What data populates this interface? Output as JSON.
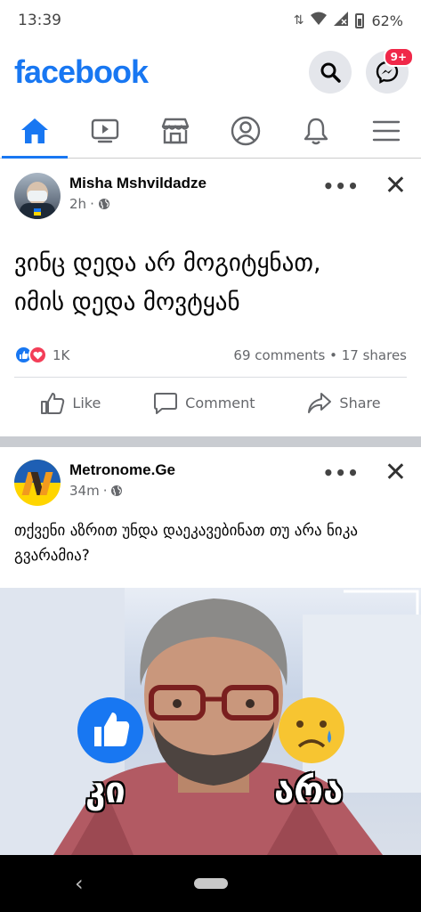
{
  "status": {
    "time": "13:39",
    "battery": "62%"
  },
  "header": {
    "logo": "facebook",
    "messenger_badge": "9+"
  },
  "nav": {
    "tabs": [
      "home",
      "watch",
      "marketplace",
      "profile",
      "notifications",
      "menu"
    ]
  },
  "post1": {
    "author": "Misha Mshvildadze",
    "time": "2h",
    "text_line1": "ვინც დედა არ მოგიტყნათ,",
    "text_line2": "იმის დედა მოვტყან",
    "reaction_count": "1K",
    "comments_shares": "69 comments • 17 shares",
    "actions": {
      "like": "Like",
      "comment": "Comment",
      "share": "Share"
    }
  },
  "post2": {
    "author": "Metronome.Ge",
    "time": "34m",
    "text": "თქვენი აზრით უნდა დაეკავებინათ თუ არა ნიკა გვარამია?",
    "image": {
      "label_yes": "კი",
      "label_no": "არა"
    }
  },
  "colors": {
    "brand": "#1877f2",
    "badge": "#f02849",
    "love": "#f33e58"
  }
}
